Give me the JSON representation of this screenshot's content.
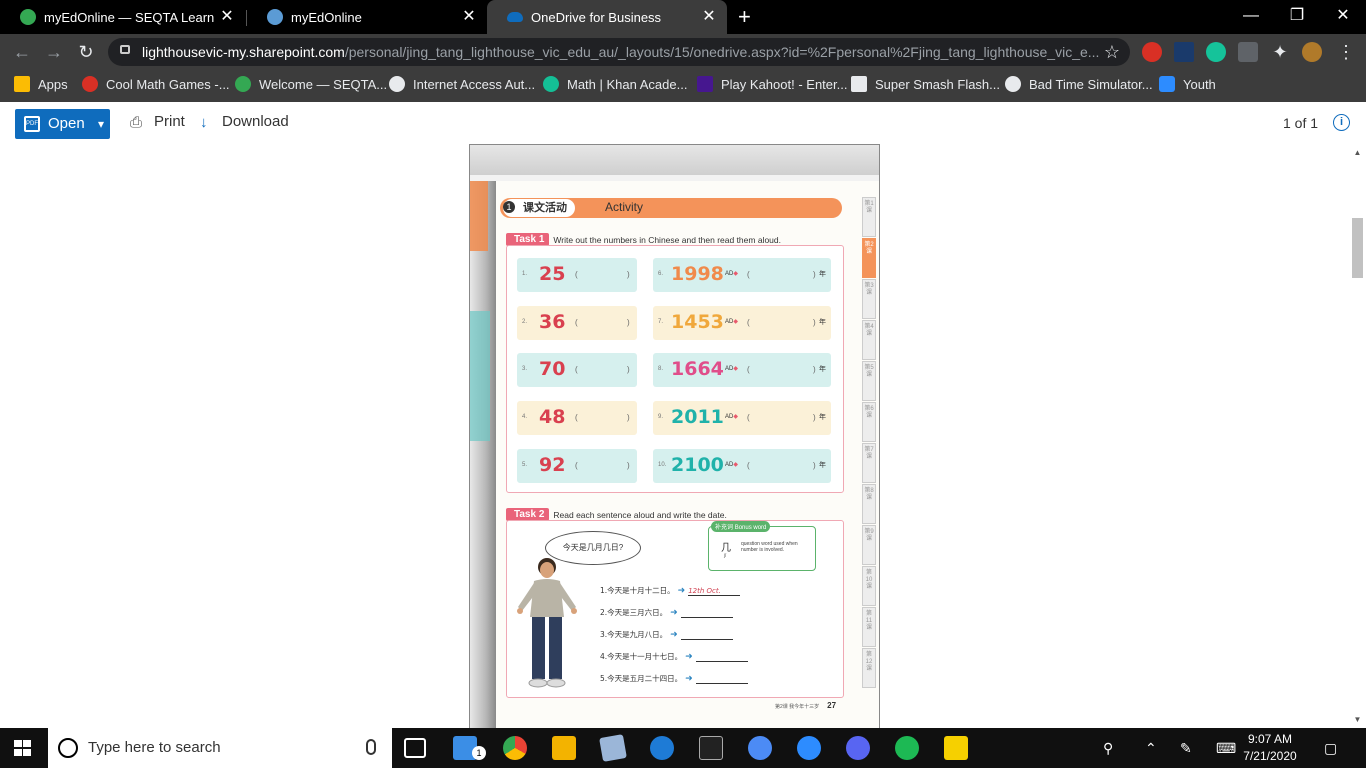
{
  "browser": {
    "tabs": [
      {
        "title": "myEdOnline — SEQTA Learn",
        "active": false
      },
      {
        "title": "myEdOnline",
        "active": false
      },
      {
        "title": "OneDrive for Business",
        "active": true
      }
    ],
    "url_host": "lighthousevic-my.sharepoint.com",
    "url_path": "/personal/jing_tang_lighthouse_vic_edu_au/_layouts/15/onedrive.aspx?id=%2Fpersonal%2Fjing_tang_lighthouse_vic_e...",
    "bookmarks": [
      {
        "label": "Apps",
        "color": "#fbbc04"
      },
      {
        "label": "Cool Math Games -...",
        "color": "#d93025"
      },
      {
        "label": "Welcome — SEQTA...",
        "color": "#34a853"
      },
      {
        "label": "Internet Access Aut...",
        "color": "#e8eaed"
      },
      {
        "label": "Math | Khan Acade...",
        "color": "#14bf96"
      },
      {
        "label": "Play Kahoot! - Enter...",
        "color": "#46178f"
      },
      {
        "label": "Super Smash Flash...",
        "color": "#e8eaed"
      },
      {
        "label": "Bad Time Simulator...",
        "color": "#e8eaed"
      },
      {
        "label": "Youth",
        "color": "#2d8cff"
      }
    ]
  },
  "onedrive": {
    "open_label": "Open",
    "print_label": "Print",
    "download_label": "Download",
    "page_count": "1 of 1"
  },
  "document": {
    "activity_zh": "课文活动",
    "activity_num": "1",
    "activity_en": "Activity",
    "task1": {
      "badge": "Task 1",
      "desc": "Write out the numbers in Chinese and then read them aloud."
    },
    "left_numbers": [
      {
        "idx": "1.",
        "value": "25",
        "color": "#d9404f",
        "bg": "#d6f0ee"
      },
      {
        "idx": "2.",
        "value": "36",
        "color": "#d9404f",
        "bg": "#fbf1d8"
      },
      {
        "idx": "3.",
        "value": "70",
        "color": "#d9404f",
        "bg": "#d6f0ee"
      },
      {
        "idx": "4.",
        "value": "48",
        "color": "#d9404f",
        "bg": "#fbf1d8"
      },
      {
        "idx": "5.",
        "value": "92",
        "color": "#d9404f",
        "bg": "#d6f0ee"
      }
    ],
    "right_numbers": [
      {
        "idx": "6.",
        "value": "1998",
        "color": "#f08a4b",
        "bg": "#d6f0ee"
      },
      {
        "idx": "7.",
        "value": "1453",
        "color": "#f0a83c",
        "bg": "#fbf1d8"
      },
      {
        "idx": "8.",
        "value": "1664",
        "color": "#e04e8a",
        "bg": "#d6f0ee"
      },
      {
        "idx": "9.",
        "value": "2011",
        "color": "#20b2aa",
        "bg": "#fbf1d8"
      },
      {
        "idx": "10.",
        "value": "2100",
        "color": "#20b2aa",
        "bg": "#d6f0ee"
      }
    ],
    "paren_open": "(",
    "paren_close": ")",
    "ad_label": "AD",
    "year_char": "年",
    "task2": {
      "badge": "Task 2",
      "desc": "Read each sentence aloud and write the date."
    },
    "speech": "今天是几月几日?",
    "bonus": {
      "head": "补充词",
      "head_en": "Bonus word",
      "char": "几",
      "pinyin": "jǐ",
      "desc": "question word used when number is involved."
    },
    "sentences": [
      {
        "text": "1.今天是十月十二日。",
        "answer": "12th Oct."
      },
      {
        "text": "2.今天是三月六日。",
        "answer": ""
      },
      {
        "text": "3.今天是九月八日。",
        "answer": ""
      },
      {
        "text": "4.今天是十一月十七日。",
        "answer": ""
      },
      {
        "text": "5.今天是五月二十四日。",
        "answer": ""
      }
    ],
    "footer_text": "第2课  我今年十三岁",
    "page_number": "27",
    "side_tabs": [
      "第1课",
      "第2课",
      "第3课",
      "第4课",
      "第5课",
      "第6课",
      "第7课",
      "第8课",
      "第9课",
      "第10课",
      "第11课",
      "第12课"
    ]
  },
  "taskbar": {
    "search_placeholder": "Type here to search",
    "time": "9:07 AM",
    "date": "7/21/2020",
    "mail_badge": "1"
  }
}
